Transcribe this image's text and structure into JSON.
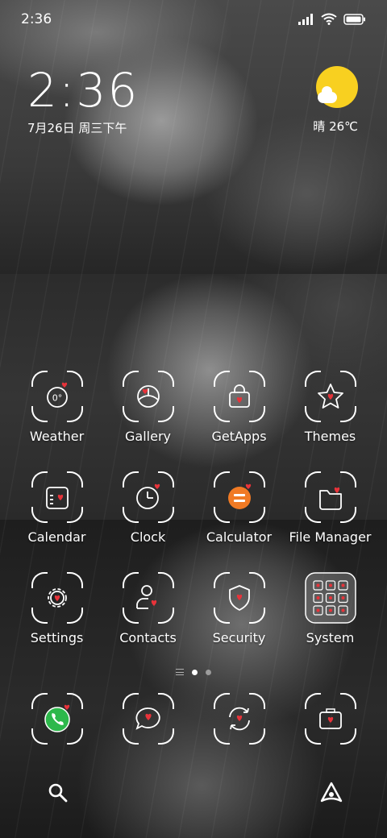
{
  "status_bar": {
    "time": "2:36",
    "icons": [
      "signal-icon",
      "wifi-icon",
      "battery-icon"
    ]
  },
  "clock_widget": {
    "time": "2:36",
    "date": "7月26日 周三下午"
  },
  "weather_widget": {
    "condition": "晴 26℃",
    "icon": "sunny-cloud-icon"
  },
  "apps": [
    {
      "label": "Weather",
      "icon": "weather-icon"
    },
    {
      "label": "Gallery",
      "icon": "gallery-icon"
    },
    {
      "label": "GetApps",
      "icon": "getapps-icon"
    },
    {
      "label": "Themes",
      "icon": "themes-icon"
    },
    {
      "label": "Calendar",
      "icon": "calendar-icon"
    },
    {
      "label": "Clock",
      "icon": "clock-icon"
    },
    {
      "label": "Calculator",
      "icon": "calculator-icon"
    },
    {
      "label": "File Manager",
      "icon": "file-manager-icon"
    },
    {
      "label": "Settings",
      "icon": "settings-icon"
    },
    {
      "label": "Contacts",
      "icon": "contacts-icon"
    },
    {
      "label": "Security",
      "icon": "security-icon"
    },
    {
      "label": "System",
      "icon": "system-folder-icon"
    }
  ],
  "weather_icon_text": "0°",
  "page_indicator": {
    "pages": 2,
    "current": 1
  },
  "dock": [
    {
      "icon": "phone-icon"
    },
    {
      "icon": "messages-icon"
    },
    {
      "icon": "browser-icon"
    },
    {
      "icon": "camera-icon"
    }
  ],
  "bottom_bar": {
    "left": "search-icon",
    "right": "assistant-icon"
  },
  "colors": {
    "heart": "#e8333a",
    "weather_sun": "#f8d020",
    "calculator": "#f07a24",
    "phone": "#2db84b",
    "text": "#ffffff"
  }
}
